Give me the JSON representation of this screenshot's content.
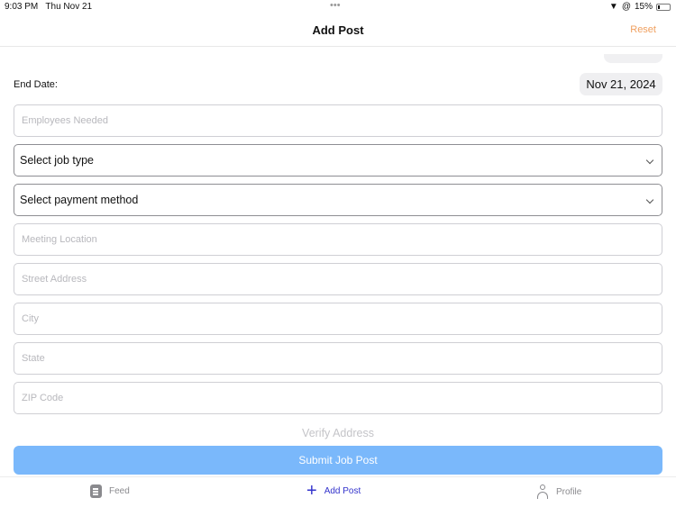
{
  "status_bar": {
    "time": "9:03 PM",
    "date": "Thu Nov 21",
    "more": "•••",
    "battery": "15%"
  },
  "nav": {
    "title": "Add Post",
    "reset": "Reset"
  },
  "end_date": {
    "label": "End Date:",
    "value": "Nov 21, 2024"
  },
  "fields": {
    "employees": "Employees Needed",
    "job_type": "Select job type",
    "payment": "Select payment method",
    "meeting": "Meeting Location",
    "street": "Street Address",
    "city": "City",
    "state": "State",
    "zip": "ZIP Code"
  },
  "verify": "Verify Address",
  "submit": "Submit Job Post",
  "tabs": [
    {
      "label": "Feed"
    },
    {
      "label": "Add Post"
    },
    {
      "label": "Profile"
    }
  ],
  "colors": {
    "accent": "#3333cc",
    "submit": "#7ab8fb",
    "reset": "#f0a060"
  }
}
